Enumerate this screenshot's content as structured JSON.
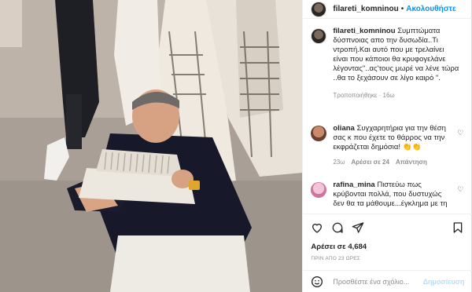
{
  "post": {
    "username": "filareti_komninou",
    "follow_label": "Ακολουθήστε",
    "dot": "•",
    "caption": "Συμπτώματα δύσπνοιας απο την δυσωδία..Τι ντροπή.Και αυτό που με τρελαίνει είναι που κάποιοι θα κρυφογελάνε λέγοντας\"..ας'τους μωρέ να λένε τώρα ..θα το ξεχάσουν σε λίγο καιρό \".",
    "caption_meta": "Τροποποιήθηκε · 16ω"
  },
  "comments": [
    {
      "username": "oliana",
      "text": "Συγχαρητήρια για την θέση σας κ που έχετε το θάρρος να την εκφράζεται δημόσια! 👏👏",
      "time": "23ω",
      "likes": "Αρέσει σε 24",
      "reply": "Απάντηση",
      "avatar_color": "#c98a6b"
    },
    {
      "username": "rafina_mina",
      "text": "Πιστεύω πως κρύβονται πολλά, που δυστυχώς δεν θα τα μάθουμε...έγκλημα με τη",
      "avatar_color": "#e8a7c4"
    }
  ],
  "actions": {
    "icons": [
      "heart-icon",
      "comment-icon",
      "share-icon",
      "bookmark-icon"
    ],
    "likes": "Αρέσει σε 4,684",
    "time_ago": "ΠΡΙΝ ΑΠΟ 23 ΩΡΕΣ"
  },
  "add_comment": {
    "placeholder": "Προσθέστε ένα σχόλιο...",
    "post_label": "Δημοσίευση",
    "emoji_icon": "smiley-icon"
  },
  "colors": {
    "accent": "#0095f6",
    "post_disabled": "#b2dffc",
    "muted": "#8e8e8e"
  }
}
